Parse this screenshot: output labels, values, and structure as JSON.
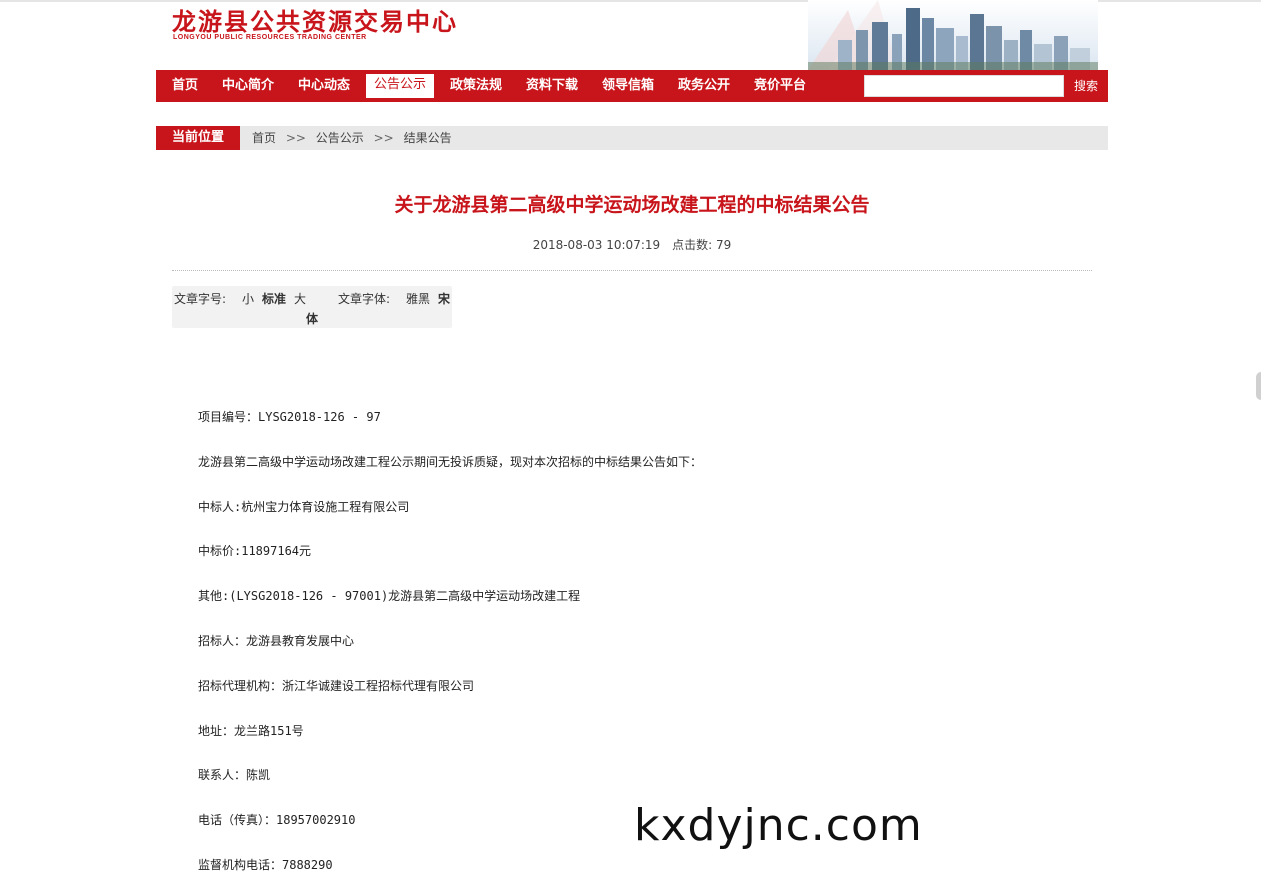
{
  "header": {
    "logo_cn": "龙游县公共资源交易中心",
    "logo_en": "LONGYOU PUBLIC RESOURCES TRADING CENTER",
    "brand_color": "#c8151b"
  },
  "nav": {
    "items": [
      {
        "label": "首页"
      },
      {
        "label": "中心简介"
      },
      {
        "label": "中心动态"
      },
      {
        "label": "公告公示",
        "active": true
      },
      {
        "label": "政策法规"
      },
      {
        "label": "资料下载"
      },
      {
        "label": "领导信箱"
      },
      {
        "label": "政务公开"
      },
      {
        "label": "竞价平台"
      }
    ],
    "search_value": "",
    "search_button": "搜索"
  },
  "breadcrumb": {
    "label": "当前位置",
    "items": [
      "首页",
      "公告公示",
      "结果公告"
    ],
    "separator": ">>"
  },
  "article": {
    "title": "关于龙游县第二高级中学运动场改建工程的中标结果公告",
    "date": "2018-08-03 10:07:19",
    "hits_label": "点击数:",
    "hits": "79"
  },
  "font_controls": {
    "size_label": "文章字号:",
    "size_small": "小",
    "size_standard": "标准",
    "size_large": "大",
    "face_label": "文章字体:",
    "face_yahei": "雅黑",
    "face_song": "宋",
    "face_song_tail": "体"
  },
  "content": {
    "paragraphs": [
      "项目编号：LYSG2018-126 - 97",
      "龙游县第二高级中学运动场改建工程公示期间无投诉质疑，现对本次招标的中标结果公告如下：",
      "中标人:杭州宝力体育设施工程有限公司",
      "中标价:11897164元",
      "其他:(LYSG2018-126 - 97001)龙游县第二高级中学运动场改建工程",
      "招标人：龙游县教育发展中心",
      "招标代理机构：浙江华诚建设工程招标代理有限公司",
      "地址：龙兰路151号",
      "联系人：陈凯",
      "电话（传真）：18957002910",
      "监督机构电话：7888290"
    ]
  },
  "watermark": "kxdyjnc.com"
}
